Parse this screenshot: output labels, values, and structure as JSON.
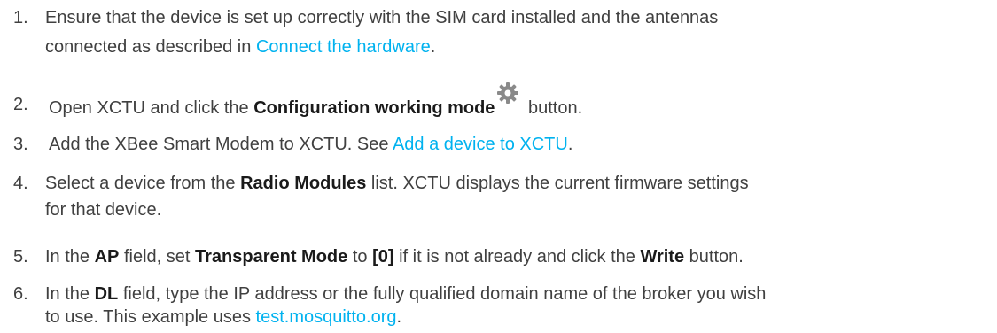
{
  "steps": [
    {
      "number": "1.",
      "t1": "Ensure that the device is set up correctly with the SIM card installed and the antennas",
      "t2": "connected as described in ",
      "link": "Connect the hardware",
      "t3": "."
    },
    {
      "number": "2.",
      "t1": "Open XCTU and click the ",
      "b1": "Configuration working mode",
      "t2": " button."
    },
    {
      "number": "3.",
      "t1": "Add the XBee Smart Modem to XCTU. See ",
      "link": "Add a device to XCTU",
      "t2": "."
    },
    {
      "number": "4.",
      "t1": "Select a device from the ",
      "b1": "Radio Modules",
      "t2": " list. XCTU displays the current firmware settings",
      "t3": "for that device."
    },
    {
      "number": "5.",
      "t1": "In the ",
      "b1": "AP",
      "t2": " field, set ",
      "b2": "Transparent Mode",
      "t3": " to ",
      "b3": "[0]",
      "t4": " if it is not already and click the ",
      "b4": "Write",
      "t5": " button."
    },
    {
      "number": "6.",
      "t1": "In the ",
      "b1": "DL",
      "t2": " field, type the IP address or the fully qualified domain name of the broker you wish",
      "t3": "to use. This example uses ",
      "link": "test.mosquitto.org",
      "t4": "."
    }
  ],
  "icons": {
    "gear": "gear-icon"
  },
  "colors": {
    "text": "#404040",
    "link": "#00b2ef",
    "icon": "#8a8a8a"
  }
}
